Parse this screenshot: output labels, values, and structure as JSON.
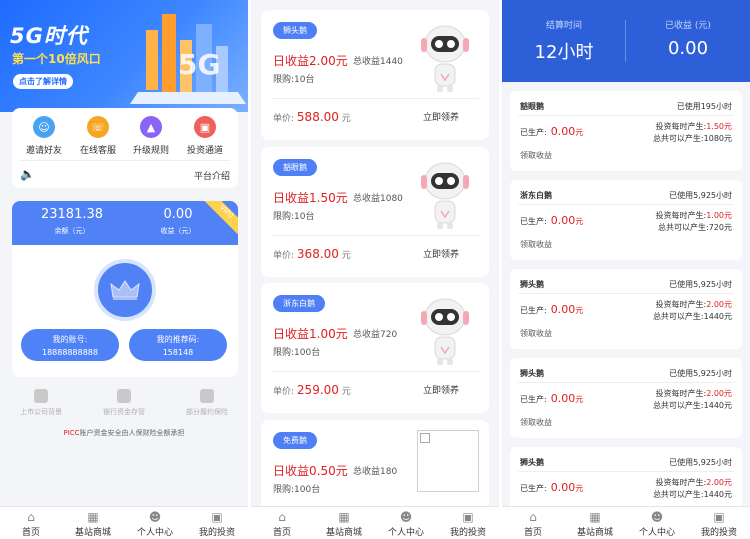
{
  "home": {
    "banner": {
      "title": "5G时代",
      "subtitle": "第一个10倍风口",
      "button": "点击了解详情"
    },
    "menu": [
      {
        "label": "邀请好友",
        "icon": "invite-icon",
        "color": "#4aa3f0"
      },
      {
        "label": "在线客服",
        "icon": "service-icon",
        "color": "#f5a623"
      },
      {
        "label": "升级规则",
        "icon": "upgrade-icon",
        "color": "#8b63f5"
      },
      {
        "label": "投资通道",
        "icon": "invest-icon",
        "color": "#f0605a"
      }
    ],
    "platform_intro": "平台介绍",
    "account": {
      "balance": "23181.38",
      "balance_label": "余额（元）",
      "income": "0.00",
      "income_label": "收益（元）",
      "vip": "VIP0",
      "my_account_label": "我的账号:",
      "my_account": "18888888888",
      "referral_label": "我的推荐码:",
      "referral": "158148"
    },
    "features": [
      "上市公司背景",
      "银行资金存管",
      "部分履约保险"
    ],
    "picc_brand": "PICC",
    "picc_text": "账户资金安全由人保财险全额承担"
  },
  "tabs": [
    {
      "label": "首页",
      "icon": "home-icon"
    },
    {
      "label": "基站商城",
      "icon": "shop-icon"
    },
    {
      "label": "个人中心",
      "icon": "user-icon"
    },
    {
      "label": "我的投资",
      "icon": "investment-icon"
    }
  ],
  "products": [
    {
      "tag": "狮头鹅",
      "daily": "日收益2.00元",
      "total": "总收益1440",
      "limit": "限购:10台",
      "price_label": "单价:",
      "price": "588.00",
      "unit": "元",
      "buy": "立即领养"
    },
    {
      "tag": "豁眼鹅",
      "daily": "日收益1.50元",
      "total": "总收益1080",
      "limit": "限购:10台",
      "price_label": "单价:",
      "price": "368.00",
      "unit": "元",
      "buy": "立即领养"
    },
    {
      "tag": "浙东白鹅",
      "daily": "日收益1.00元",
      "total": "总收益720",
      "limit": "限购:100台",
      "price_label": "单价:",
      "price": "259.00",
      "unit": "元",
      "buy": "立即领养"
    },
    {
      "tag": "免费鹅",
      "daily": "日收益0.50元",
      "total": "总收益180",
      "limit": "限购:100台"
    }
  ],
  "investments": {
    "settle_label": "结算时间",
    "settle_value": "12小时",
    "earned_label": "已收益 (元)",
    "earned_value": "0.00",
    "produced_label": "已生产:",
    "hourly_label": "投资每时产生:",
    "total_label": "总共可以产生:",
    "collect_label": "领取收益",
    "items": [
      {
        "name": "豁眼鹅",
        "used": "已使用195小时",
        "produced": "0.00",
        "unit": "元",
        "hourly": "1.50元",
        "total": "1080元"
      },
      {
        "name": "浙东白鹅",
        "used": "已使用5,925小时",
        "produced": "0.00",
        "unit": "元",
        "hourly": "1.00元",
        "total": "720元"
      },
      {
        "name": "狮头鹅",
        "used": "已使用5,925小时",
        "produced": "0.00",
        "unit": "元",
        "hourly": "2.00元",
        "total": "1440元"
      },
      {
        "name": "狮头鹅",
        "used": "已使用5,925小时",
        "produced": "0.00",
        "unit": "元",
        "hourly": "2.00元",
        "total": "1440元"
      },
      {
        "name": "狮头鹅",
        "used": "已使用5,925小时",
        "produced": "0.00",
        "unit": "元",
        "hourly": "2.00元",
        "total": "1440元"
      }
    ]
  }
}
